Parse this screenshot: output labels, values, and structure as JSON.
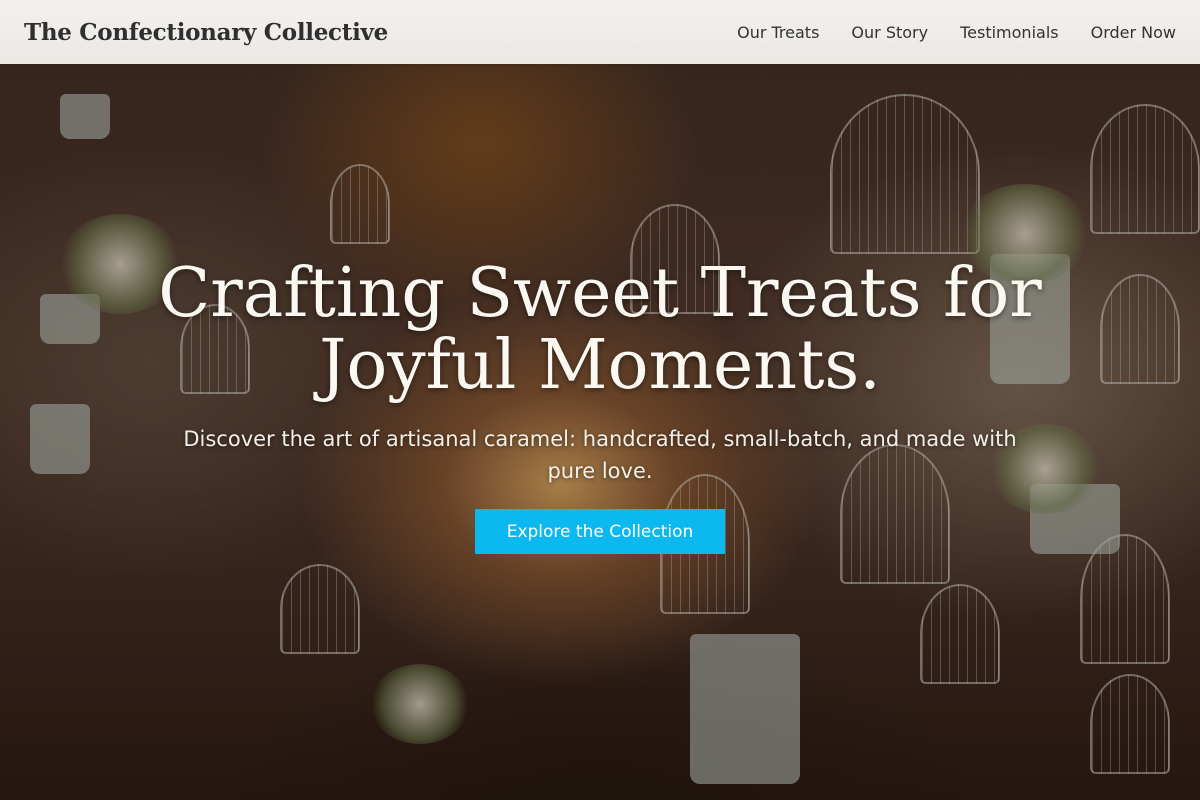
{
  "header": {
    "brand": "The Confectionary Collective",
    "nav": [
      {
        "label": "Our Treats"
      },
      {
        "label": "Our Story"
      },
      {
        "label": "Testimonials"
      },
      {
        "label": "Order Now"
      }
    ]
  },
  "hero": {
    "headline": "Crafting Sweet Treats for Joyful Moments.",
    "subheadline": "Discover the art of artisanal caramel: handcrafted, small-batch, and made with pure love.",
    "cta_label": "Explore the Collection"
  },
  "colors": {
    "cta_background": "#0bb8f0",
    "header_background": "#efedea",
    "brand_text": "#2f2f2f"
  }
}
